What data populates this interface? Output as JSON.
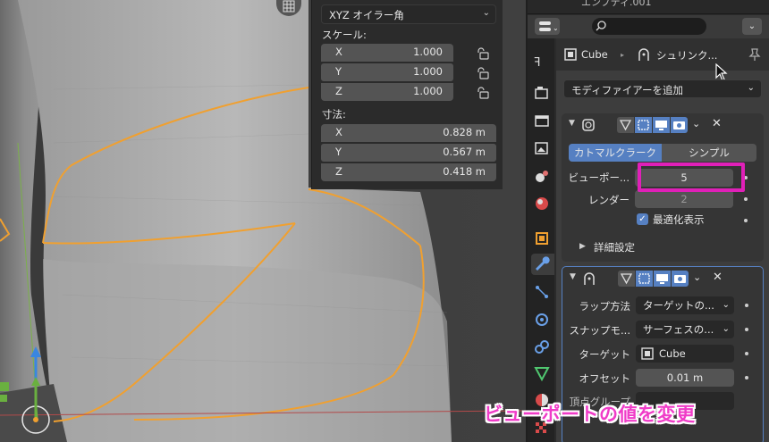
{
  "viewport": {
    "rotation_dropdown": "XYZ オイラー角",
    "scale_label": "スケール:",
    "scale": [
      {
        "axis": "X",
        "value": "1.000"
      },
      {
        "axis": "Y",
        "value": "1.000"
      },
      {
        "axis": "Z",
        "value": "1.000"
      }
    ],
    "dimensions_label": "寸法:",
    "dimensions": [
      {
        "axis": "X",
        "value": "0.828 m"
      },
      {
        "axis": "Y",
        "value": "0.567 m"
      },
      {
        "axis": "Z",
        "value": "0.418 m"
      }
    ]
  },
  "outliner": {
    "partial_text": "エンプティ.001"
  },
  "properties": {
    "breadcrumb_object": "Cube",
    "breadcrumb_modifier": "シュリンク...",
    "add_modifier": "モディファイアーを追加",
    "subsurf": {
      "tab_catmull": "カトマルクラーク",
      "tab_simple": "シンプル",
      "viewport_label": "ビューポー...",
      "viewport_value": "5",
      "render_label": "レンダー",
      "render_value": "2",
      "optimal_display": "最適化表示",
      "advanced": "詳細設定"
    },
    "shrinkwrap": {
      "wrap_method_label": "ラップ方法",
      "wrap_method_value": "ターゲットの...",
      "snap_mode_label": "スナップモ...",
      "snap_mode_value": "サーフェスの...",
      "target_label": "ターゲット",
      "target_value": "Cube",
      "offset_label": "オフセット",
      "offset_value": "0.01 m",
      "vertex_group_label": "頂点グループ"
    }
  },
  "caption": "ビューポートの値を変更",
  "colors": {
    "accent": "#5680c2",
    "highlight": "#e020b8",
    "selection_outline": "#f0a030"
  }
}
